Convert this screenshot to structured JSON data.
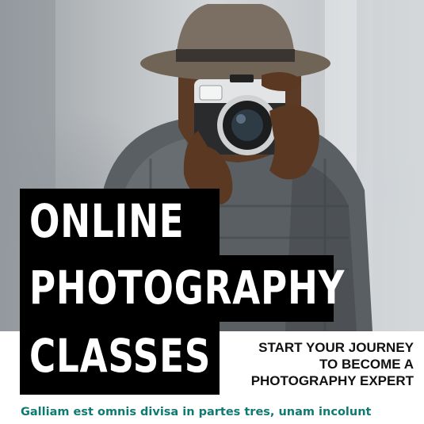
{
  "poster": {
    "title_lines": [
      "ONLINE",
      "PHOTOGRAPHY",
      "CLASSES"
    ],
    "subtitle_lines": [
      "START YOUR JOURNEY",
      "TO BECOME A",
      "PHOTOGRAPHY EXPERT"
    ],
    "body_text": "Galliam est omnis divisa in partes tres, unam incolunt"
  },
  "colors": {
    "title_bg": "#000000",
    "title_text": "#ffffff",
    "subtitle_text": "#111111",
    "body_text": "#0f7a72"
  }
}
